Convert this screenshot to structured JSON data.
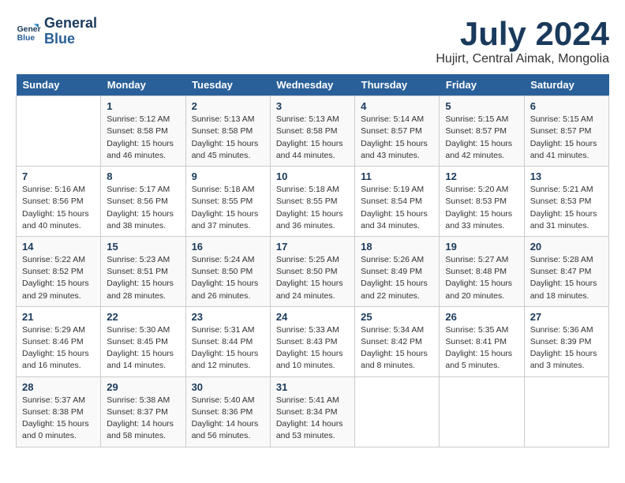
{
  "logo": {
    "line1": "General",
    "line2": "Blue"
  },
  "header": {
    "month": "July 2024",
    "location": "Hujirt, Central Aimak, Mongolia"
  },
  "columns": [
    "Sunday",
    "Monday",
    "Tuesday",
    "Wednesday",
    "Thursday",
    "Friday",
    "Saturday"
  ],
  "weeks": [
    [
      {
        "day": "",
        "info": ""
      },
      {
        "day": "1",
        "info": "Sunrise: 5:12 AM\nSunset: 8:58 PM\nDaylight: 15 hours\nand 46 minutes."
      },
      {
        "day": "2",
        "info": "Sunrise: 5:13 AM\nSunset: 8:58 PM\nDaylight: 15 hours\nand 45 minutes."
      },
      {
        "day": "3",
        "info": "Sunrise: 5:13 AM\nSunset: 8:58 PM\nDaylight: 15 hours\nand 44 minutes."
      },
      {
        "day": "4",
        "info": "Sunrise: 5:14 AM\nSunset: 8:57 PM\nDaylight: 15 hours\nand 43 minutes."
      },
      {
        "day": "5",
        "info": "Sunrise: 5:15 AM\nSunset: 8:57 PM\nDaylight: 15 hours\nand 42 minutes."
      },
      {
        "day": "6",
        "info": "Sunrise: 5:15 AM\nSunset: 8:57 PM\nDaylight: 15 hours\nand 41 minutes."
      }
    ],
    [
      {
        "day": "7",
        "info": "Sunrise: 5:16 AM\nSunset: 8:56 PM\nDaylight: 15 hours\nand 40 minutes."
      },
      {
        "day": "8",
        "info": "Sunrise: 5:17 AM\nSunset: 8:56 PM\nDaylight: 15 hours\nand 38 minutes."
      },
      {
        "day": "9",
        "info": "Sunrise: 5:18 AM\nSunset: 8:55 PM\nDaylight: 15 hours\nand 37 minutes."
      },
      {
        "day": "10",
        "info": "Sunrise: 5:18 AM\nSunset: 8:55 PM\nDaylight: 15 hours\nand 36 minutes."
      },
      {
        "day": "11",
        "info": "Sunrise: 5:19 AM\nSunset: 8:54 PM\nDaylight: 15 hours\nand 34 minutes."
      },
      {
        "day": "12",
        "info": "Sunrise: 5:20 AM\nSunset: 8:53 PM\nDaylight: 15 hours\nand 33 minutes."
      },
      {
        "day": "13",
        "info": "Sunrise: 5:21 AM\nSunset: 8:53 PM\nDaylight: 15 hours\nand 31 minutes."
      }
    ],
    [
      {
        "day": "14",
        "info": "Sunrise: 5:22 AM\nSunset: 8:52 PM\nDaylight: 15 hours\nand 29 minutes."
      },
      {
        "day": "15",
        "info": "Sunrise: 5:23 AM\nSunset: 8:51 PM\nDaylight: 15 hours\nand 28 minutes."
      },
      {
        "day": "16",
        "info": "Sunrise: 5:24 AM\nSunset: 8:50 PM\nDaylight: 15 hours\nand 26 minutes."
      },
      {
        "day": "17",
        "info": "Sunrise: 5:25 AM\nSunset: 8:50 PM\nDaylight: 15 hours\nand 24 minutes."
      },
      {
        "day": "18",
        "info": "Sunrise: 5:26 AM\nSunset: 8:49 PM\nDaylight: 15 hours\nand 22 minutes."
      },
      {
        "day": "19",
        "info": "Sunrise: 5:27 AM\nSunset: 8:48 PM\nDaylight: 15 hours\nand 20 minutes."
      },
      {
        "day": "20",
        "info": "Sunrise: 5:28 AM\nSunset: 8:47 PM\nDaylight: 15 hours\nand 18 minutes."
      }
    ],
    [
      {
        "day": "21",
        "info": "Sunrise: 5:29 AM\nSunset: 8:46 PM\nDaylight: 15 hours\nand 16 minutes."
      },
      {
        "day": "22",
        "info": "Sunrise: 5:30 AM\nSunset: 8:45 PM\nDaylight: 15 hours\nand 14 minutes."
      },
      {
        "day": "23",
        "info": "Sunrise: 5:31 AM\nSunset: 8:44 PM\nDaylight: 15 hours\nand 12 minutes."
      },
      {
        "day": "24",
        "info": "Sunrise: 5:33 AM\nSunset: 8:43 PM\nDaylight: 15 hours\nand 10 minutes."
      },
      {
        "day": "25",
        "info": "Sunrise: 5:34 AM\nSunset: 8:42 PM\nDaylight: 15 hours\nand 8 minutes."
      },
      {
        "day": "26",
        "info": "Sunrise: 5:35 AM\nSunset: 8:41 PM\nDaylight: 15 hours\nand 5 minutes."
      },
      {
        "day": "27",
        "info": "Sunrise: 5:36 AM\nSunset: 8:39 PM\nDaylight: 15 hours\nand 3 minutes."
      }
    ],
    [
      {
        "day": "28",
        "info": "Sunrise: 5:37 AM\nSunset: 8:38 PM\nDaylight: 15 hours\nand 0 minutes."
      },
      {
        "day": "29",
        "info": "Sunrise: 5:38 AM\nSunset: 8:37 PM\nDaylight: 14 hours\nand 58 minutes."
      },
      {
        "day": "30",
        "info": "Sunrise: 5:40 AM\nSunset: 8:36 PM\nDaylight: 14 hours\nand 56 minutes."
      },
      {
        "day": "31",
        "info": "Sunrise: 5:41 AM\nSunset: 8:34 PM\nDaylight: 14 hours\nand 53 minutes."
      },
      {
        "day": "",
        "info": ""
      },
      {
        "day": "",
        "info": ""
      },
      {
        "day": "",
        "info": ""
      }
    ]
  ]
}
